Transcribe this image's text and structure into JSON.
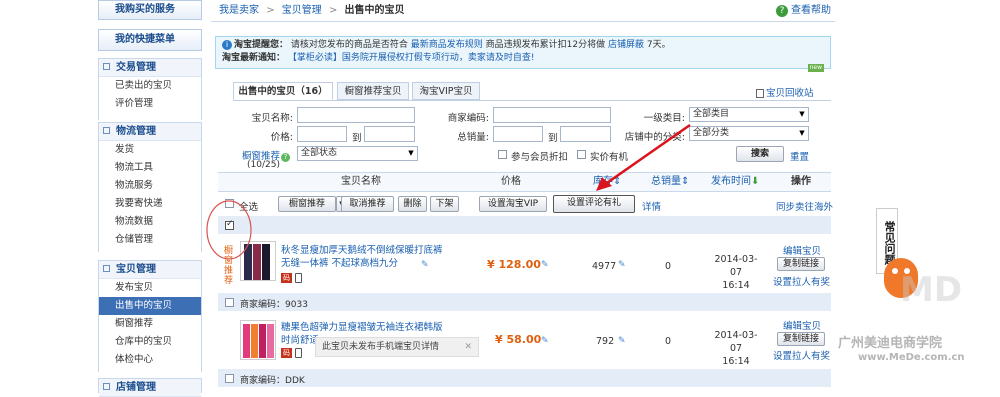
{
  "sidebar": {
    "purchased": "我购买的服务",
    "shortcuts": "我的快捷菜单",
    "groups": [
      {
        "title": "交易管理",
        "items": [
          "已卖出的宝贝",
          "评价管理"
        ]
      },
      {
        "title": "物流管理",
        "items": [
          "发货",
          "物流工具",
          "物流服务",
          "我要寄快递",
          "物流数据",
          "仓储管理"
        ]
      },
      {
        "title": "宝贝管理",
        "items": [
          "发布宝贝",
          "出售中的宝贝",
          "橱窗推荐",
          "仓库中的宝贝",
          "体检中心"
        ]
      },
      {
        "title": "店铺管理",
        "items": []
      }
    ]
  },
  "breadcrumb": {
    "a": "我是卖家",
    "b": "宝贝管理",
    "c": "出售中的宝贝",
    "sep": ">"
  },
  "help": "查看帮助",
  "notice": {
    "line1_label": "淘宝提醒您：",
    "line1_text": "请核对您发布的商品是否符合",
    "line1_link": "最新商品发布规则",
    "line1_tail": "商品违规发布累计扣12分将做",
    "line1_link2": "店铺屏蔽",
    "line1_end": "7天。",
    "line2_label": "淘宝最新通知：",
    "line2_text": "【掌柜必读】国务院开展侵权打假专项行动，卖家请及时自查!",
    "new_badge": "new"
  },
  "tabs": [
    "出售中的宝贝（16）",
    "橱窗推荐宝贝",
    "淘宝VIP宝贝"
  ],
  "recycle": "宝贝回收站",
  "form": {
    "name_lbl": "宝贝名称:",
    "price_lbl": "价格:",
    "to": "到",
    "code_lbl": "商家编码:",
    "sales_lbl": "总销量:",
    "cat1_lbl": "一级类目:",
    "cat1_val": "全部类目",
    "shopcat_lbl": "店铺中的分类:",
    "shopcat_val": "全部分类",
    "window_lbl": "橱窗推荐",
    "window_count": "(10/25)",
    "status_val": "全部状态",
    "member_discount": "参与会员折扣",
    "real_item": "实价有机",
    "search_btn": "搜索",
    "reset": "重置"
  },
  "table": {
    "col_name": "宝贝名称",
    "col_price": "价格",
    "col_stock": "库存",
    "col_sales": "总销量",
    "col_time": "发布时间",
    "col_op": "操作",
    "select_all": "全选",
    "btns": [
      "橱窗推荐",
      "取消推荐",
      "删除",
      "下架",
      "设置淘宝VIP",
      "设置评论有礼"
    ],
    "details": "详情",
    "sync": "同步卖往海外",
    "rows": [
      {
        "title_l1": "秋冬显瘦加厚天鹅绒不倒绒保暖打底裤",
        "title_l2": "无缝一体裤  不起球高档九分",
        "badge": "橱窗推荐",
        "price": "¥ 128.00",
        "stock": "4977",
        "sales": "0",
        "date": "2014-03-07",
        "time": "16:14",
        "edit": "编辑宝贝",
        "copy": "复制链接",
        "promo": "设置拉人有奖",
        "code_lbl": "商家编码：",
        "code": "9033"
      },
      {
        "title_l1": "糖果色超弹力显瘦褶皱无袖连衣裙韩版",
        "title_l2": "时尚舒适",
        "tooltip": "此宝贝未发布手机端宝贝详情",
        "price": "¥ 58.00",
        "stock": "792",
        "sales": "0",
        "date": "2014-03-07",
        "time": "16:14",
        "edit": "编辑宝贝",
        "copy": "复制链接",
        "promo": "设置拉人有奖",
        "code_lbl": "商家编码：",
        "code": "DDK"
      }
    ]
  },
  "faq": "常见问题",
  "watermark": {
    "school": "广州美迪电商学院",
    "url": "www.MeDe.com.cn"
  }
}
